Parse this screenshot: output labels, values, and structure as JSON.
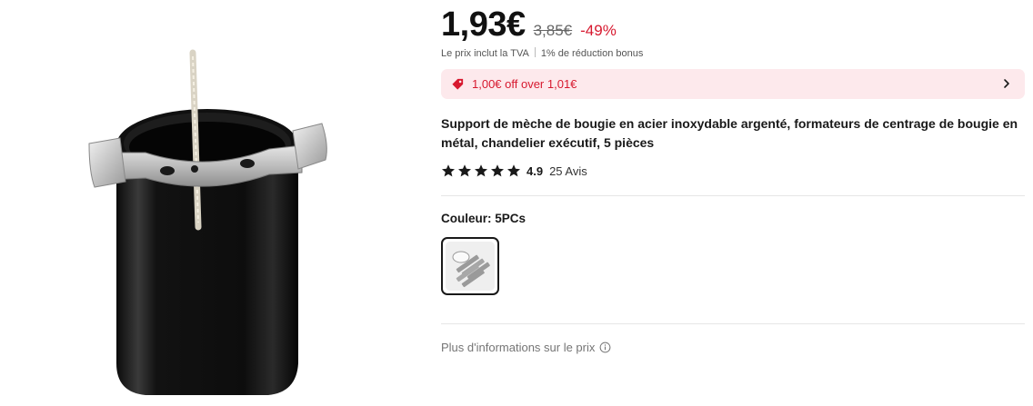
{
  "price": {
    "current": "1,93€",
    "original": "3,85€",
    "discount": "-49%",
    "vat_note": "Le prix inclut la TVA",
    "bonus_note": "1% de réduction bonus"
  },
  "coupon": {
    "text": "1,00€ off over 1,01€",
    "accent_color": "#d7192f",
    "background_color": "#fde9ec"
  },
  "product": {
    "title": "Support de mèche de bougie en acier inoxydable argenté, formateurs de centrage de bougie en métal, chandelier exécutif, 5 pièces"
  },
  "rating": {
    "stars": 5,
    "value": "4.9",
    "reviews": "25 Avis"
  },
  "variant": {
    "label": "Couleur: 5PCs"
  },
  "footer": {
    "more_info": "Plus d'informations sur le prix"
  },
  "icons": {
    "coupon": "tag-icon",
    "chevron": "chevron-right-icon",
    "star": "star-icon",
    "info": "info-circle-icon"
  }
}
